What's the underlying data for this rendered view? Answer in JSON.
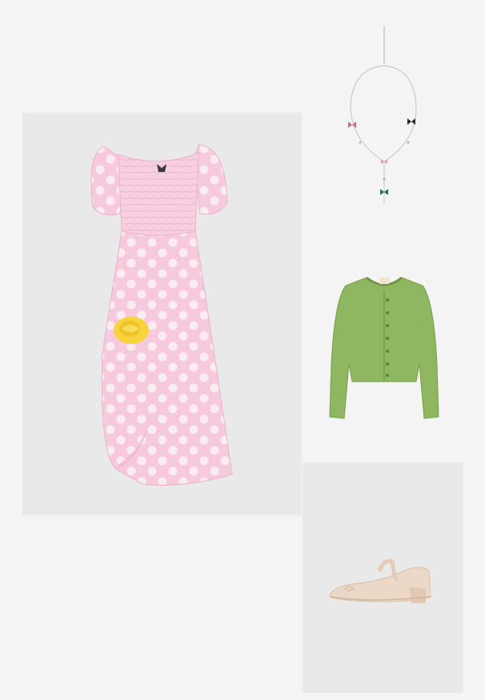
{
  "collage": {
    "items": [
      {
        "name": "dress",
        "description_color": "#f6c9dc",
        "accent_color": "#f7d33c"
      },
      {
        "name": "necklace",
        "description_color": "#b9b9b9"
      },
      {
        "name": "cardigan",
        "description_color": "#8fb660"
      },
      {
        "name": "shoe",
        "description_color": "#ecd8c6"
      }
    ],
    "background_color": "#f4f4f4",
    "panel_color": "#e9e9e9"
  }
}
